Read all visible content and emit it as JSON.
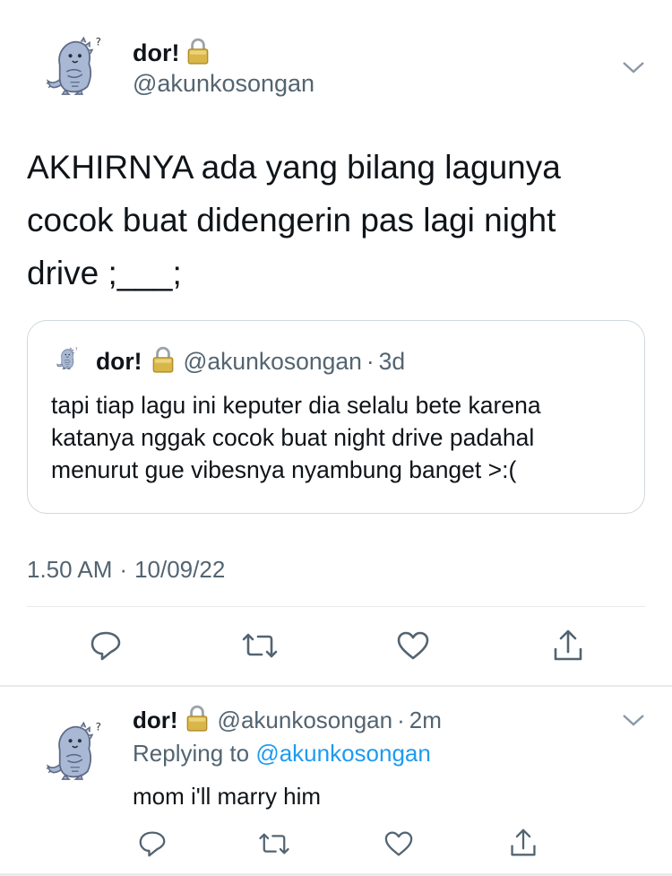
{
  "main_tweet": {
    "name": "dor!",
    "handle": "@akunkosongan",
    "text_lines": [
      "AKHIRNYA ada yang bilang lagunya",
      "cocok buat didengerin pas lagi night",
      "drive ;___;"
    ],
    "time": "1.50 AM",
    "separator": "·",
    "date": "10/09/22"
  },
  "quoted_tweet": {
    "name": "dor!",
    "handle": "@akunkosongan",
    "separator": "·",
    "age": "3d",
    "text_lines": [
      "tapi tiap lagu ini keputer dia selalu bete karena",
      "katanya nggak cocok buat night drive padahal",
      "menurut gue vibesnya nyambung banget >:("
    ]
  },
  "reply_tweet": {
    "name": "dor!",
    "handle": "@akunkosongan",
    "separator": "·",
    "age": "2m",
    "replying_prefix": "Replying to",
    "replying_handle": "@akunkosongan",
    "text": "mom i'll marry him"
  },
  "icons": [
    "reply-icon",
    "retweet-icon",
    "like-icon",
    "share-icon",
    "lock-icon",
    "chevron-down-icon"
  ],
  "colors": {
    "text": "#0f1419",
    "secondary": "#536471",
    "link": "#1d9bf0",
    "avatar": "#a9b8d4",
    "lock": "#c9a43a"
  }
}
